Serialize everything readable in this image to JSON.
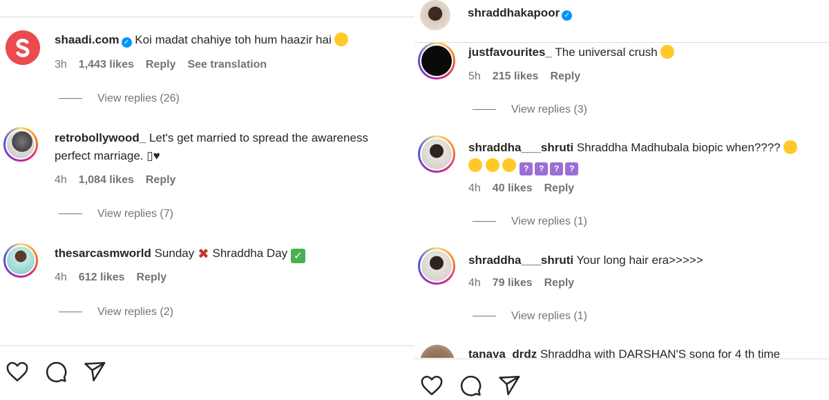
{
  "left": {
    "comments": [
      {
        "username": "shaadi.com",
        "verified": true,
        "text": "Koi madat chahiye toh hum haazir hai",
        "emoji": "star-struck",
        "time": "3h",
        "likes": "1,443 likes",
        "reply": "Reply",
        "translation": "See translation",
        "view_replies": "View replies (26)"
      },
      {
        "username": "retrobollywood_",
        "text_line1": "Let's get married to spread the awareness",
        "text_line2": "perfect marriage. ▯♥",
        "time": "4h",
        "likes": "1,084 likes",
        "reply": "Reply",
        "view_replies": "View replies (7)"
      },
      {
        "username": "thesarcasmworld",
        "text_a": "Sunday",
        "text_b": "Shraddha Day",
        "time": "4h",
        "likes": "612 likes",
        "reply": "Reply",
        "view_replies": "View replies (2)"
      }
    ]
  },
  "right": {
    "header_username": "shraddhakapoor",
    "comments": [
      {
        "username": "justfavourites_",
        "text": "The universal crush",
        "time": "5h",
        "likes": "215 likes",
        "reply": "Reply",
        "view_replies": "View replies (3)"
      },
      {
        "username": "shraddha___shruti",
        "text": "Shraddha Madhubala biopic when????",
        "time": "4h",
        "likes": "40 likes",
        "reply": "Reply",
        "view_replies": "View replies (1)"
      },
      {
        "username": "shraddha___shruti",
        "text": "Your long hair era>>>>>",
        "time": "4h",
        "likes": "79 likes",
        "reply": "Reply",
        "view_replies": "View replies (1)"
      },
      {
        "username": "tanaya_drdz",
        "text": "Shraddha with DARSHAN'S song for 4 th time"
      }
    ]
  },
  "icons": [
    "heart-icon",
    "comment-icon",
    "share-icon",
    "verified-icon"
  ],
  "colors": {
    "accent": "#0095f6",
    "muted": "#737373",
    "text": "#262626"
  }
}
